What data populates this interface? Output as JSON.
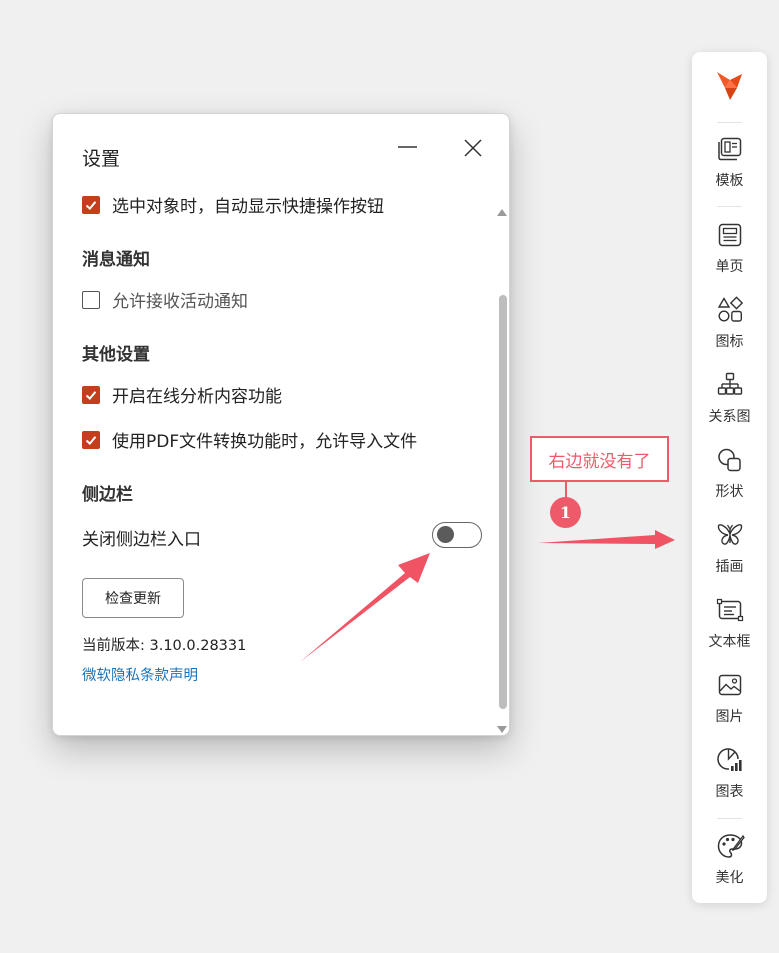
{
  "dialog": {
    "title": "设置",
    "auto_toolbar_label": "选中对象时，自动显示快捷操作按钮",
    "notifications_title": "消息通知",
    "allow_activity_label": "允许接收活动通知",
    "other_title": "其他设置",
    "online_analysis_label": "开启在线分析内容功能",
    "pdf_import_label": "使用PDF文件转换功能时，允许导入文件",
    "sidebar_title": "侧边栏",
    "close_sidebar_label": "关闭侧边栏入口",
    "close_sidebar_on": false,
    "check_update_label": "检查更新",
    "version_text": "当前版本: 3.10.0.28331",
    "privacy_link": "微软隐私条款声明"
  },
  "sidebar": {
    "items": [
      {
        "label": "模板",
        "icon": "template-icon"
      },
      {
        "label": "单页",
        "icon": "single-page-icon"
      },
      {
        "label": "图标",
        "icon": "shapes-icon"
      },
      {
        "label": "关系图",
        "icon": "hierarchy-icon"
      },
      {
        "label": "形状",
        "icon": "shape-icon"
      },
      {
        "label": "插画",
        "icon": "butterfly-icon"
      },
      {
        "label": "文本框",
        "icon": "textbox-icon"
      },
      {
        "label": "图片",
        "icon": "image-icon"
      },
      {
        "label": "图表",
        "icon": "chart-icon"
      },
      {
        "label": "美化",
        "icon": "palette-icon"
      }
    ]
  },
  "annotation": {
    "callout_text": "右边就没有了",
    "marker": "1"
  },
  "colors": {
    "accent": "#c43e1c",
    "link": "#1a73b8",
    "annotation": "#ef5a6a",
    "logo_orange": "#f05a28"
  }
}
